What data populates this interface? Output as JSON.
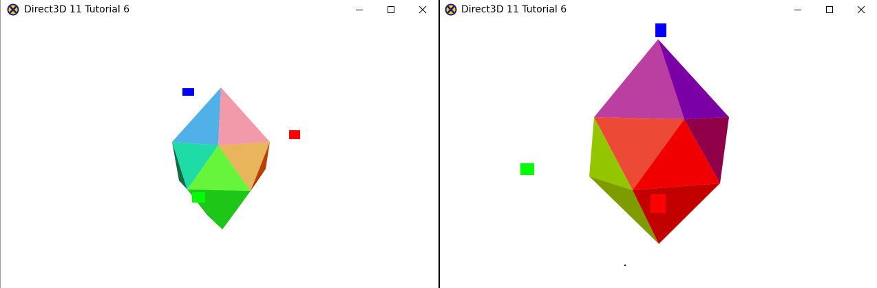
{
  "windows": [
    {
      "title": "Direct3D 11 Tutorial 6",
      "app_icon": "directx-logo-icon",
      "controls": [
        "minimize-icon",
        "maximize-icon",
        "close-icon"
      ]
    },
    {
      "title": "Direct3D 11 Tutorial 6",
      "app_icon": "directx-logo-icon",
      "controls": [
        "minimize-icon",
        "maximize-icon",
        "close-icon"
      ]
    }
  ],
  "colors": {
    "light_blue": "#58b4e8",
    "blue_marker": "#0000ff",
    "red_marker": "#ff0000",
    "green_marker": "#00ff00"
  }
}
